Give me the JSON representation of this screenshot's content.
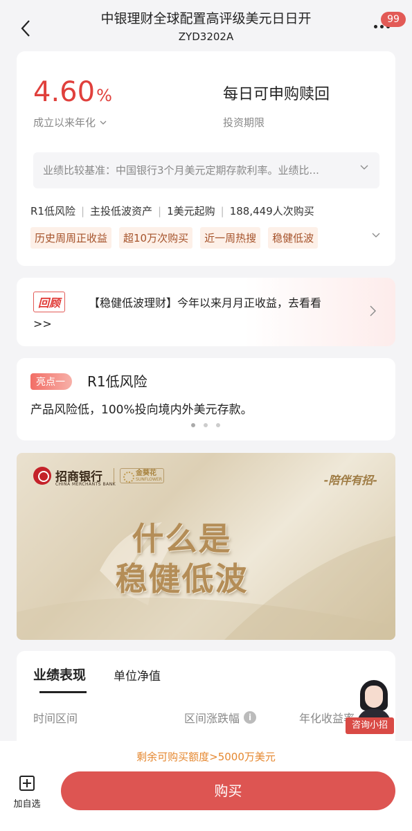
{
  "header": {
    "title": "中银理财全球配置高评级美元日日开",
    "code": "ZYD3202A",
    "badge_count": "99",
    "icons": [
      "back-arrow-icon",
      "more-dots-icon"
    ]
  },
  "summary": {
    "rate_value": "4.60",
    "rate_unit": "%",
    "rate_label": "成立以来年化",
    "period_value": "每日可申购赎回",
    "period_label": "投资期限",
    "benchmark": "业绩比较基准：中国银行3个月美元定期存款利率。业绩比...",
    "attributes": [
      "R1低风险",
      "主投低波资产",
      "1美元起购",
      "188,449人次购买"
    ],
    "tags": [
      "历史周周正收益",
      "超10万次购买",
      "近一周热搜",
      "稳健低波"
    ],
    "accent_color": "#e0403c"
  },
  "review": {
    "tag": "回顾",
    "text": "【稳健低波理财】今年以来月月正收益，去看看>>"
  },
  "highlight": {
    "tag": "亮点一",
    "title": "R1低风险",
    "desc": "产品风险低，100%投向境内外美元存款。",
    "dots_total": 3,
    "dots_active": 1
  },
  "banner": {
    "bank_name": "招商银行",
    "bank_name_en": "CHINA MERCHANTS BANK",
    "sub_brand": "金葵花",
    "sub_brand_en": "SUNFLOWER",
    "slogan": "-陪伴有招-",
    "headline_1": "什么是",
    "headline_2": "稳健低波"
  },
  "performance": {
    "tabs": [
      "业绩表现",
      "单位净值"
    ],
    "active_tab": 0,
    "columns": [
      "时间区间",
      "区间涨跌幅",
      "年化收益率"
    ]
  },
  "assistant": {
    "label": "咨询小招"
  },
  "footer": {
    "quota": "剩余可购买额度>5000万美元",
    "favorite_label": "加自选",
    "buy_label": "购买",
    "buy_color": "#dd5552"
  }
}
